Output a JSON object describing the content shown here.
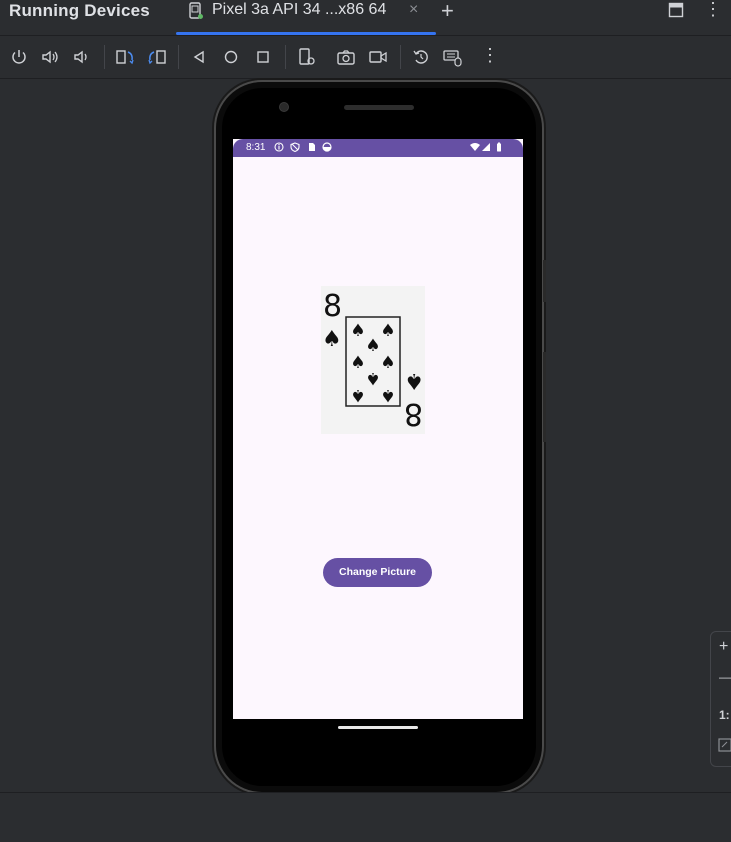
{
  "panel": {
    "title": "Running Devices"
  },
  "tab": {
    "label": "Pixel 3a API 34 ...x86 64",
    "close": "×"
  },
  "add_tab": "+",
  "window": {
    "more": "⋮"
  },
  "toolbar": {
    "icons": [
      "power-icon",
      "volume-up-icon",
      "volume-down-icon",
      "rotate-left-icon",
      "rotate-right-icon",
      "back-icon",
      "home-icon",
      "overview-icon",
      "device-settings-icon",
      "screenshot-icon",
      "screen-record-icon",
      "reset-icon",
      "keyboard-mouse-icon",
      "more-icon"
    ],
    "more": "⋮"
  },
  "device": {
    "status_time": "8:31",
    "status_icons": [
      "info-icon",
      "shield-icon",
      "sim-icon",
      "data-saver-icon",
      "wifi-icon",
      "signal-icon",
      "battery-icon"
    ],
    "card": {
      "rank": "8",
      "suit": "♠",
      "pips": 8
    },
    "button_label": "Change Picture",
    "colors": {
      "primary": "#6650a4",
      "screen_bg": "#fdf7fe"
    }
  },
  "zoom": {
    "plus": "+",
    "minus": "—",
    "ratio": "1:"
  }
}
